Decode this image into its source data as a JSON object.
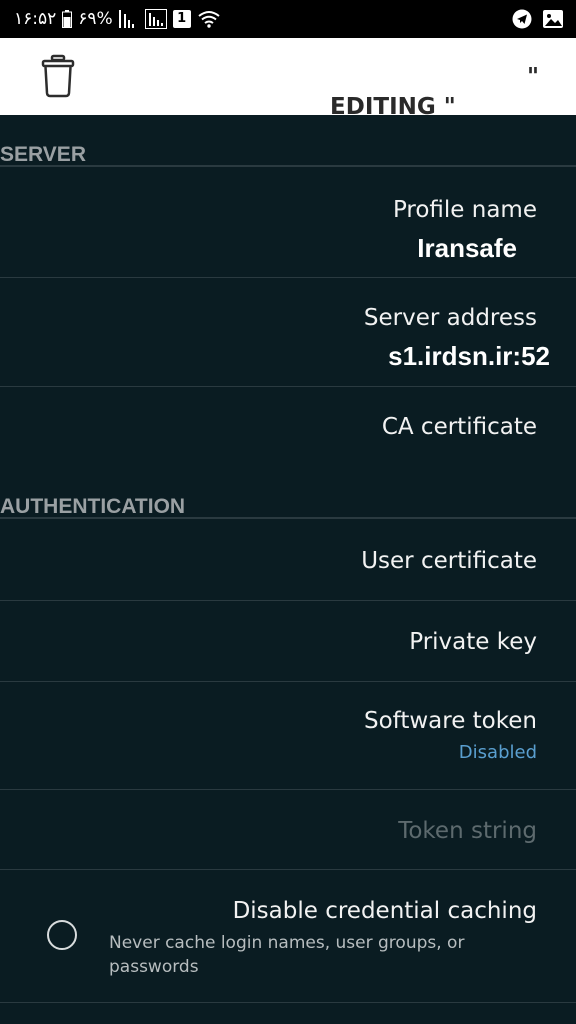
{
  "status_bar": {
    "time": "۱۶:۵۲",
    "battery": "۶۹%",
    "sim_badge": "1"
  },
  "toolbar": {
    "title": "EDITING \"",
    "title_close": "\""
  },
  "sections": {
    "server": "SERVER",
    "authentication": "AUTHENTICATION"
  },
  "server": {
    "profile_name_label": "Profile name",
    "profile_name_value": "Iransafe",
    "server_address_label": "Server address",
    "server_address_value": "s1.irdsn.ir:52",
    "ca_certificate_label": "CA certificate"
  },
  "authentication": {
    "user_certificate_label": "User certificate",
    "private_key_label": "Private key",
    "software_token_label": "Software token",
    "software_token_value": "Disabled",
    "token_string_label": "Token string",
    "disable_caching_label": "Disable credential caching",
    "disable_caching_desc": "Never cache login names, user groups, or passwords",
    "disable_caching_checked": false
  },
  "colors": {
    "background": "#0a1c22",
    "toolbar": "#ffffff",
    "accent": "#5a9fd0",
    "section_header": "#9aa0a3"
  }
}
